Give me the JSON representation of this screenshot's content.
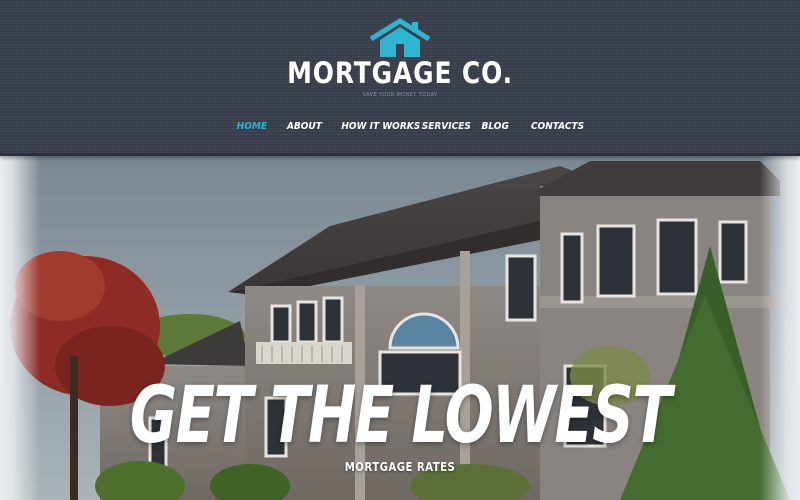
{
  "brand": {
    "title": "MORTGAGE CO.",
    "tagline": "SAVE YOUR MONEY TODAY",
    "logo_icon": "house-icon",
    "accent_color": "#2fb5cf"
  },
  "nav": {
    "items": [
      {
        "label": "HOME",
        "active": true
      },
      {
        "label": "ABOUT",
        "active": false
      },
      {
        "label": "HOW IT WORKS",
        "active": false
      },
      {
        "label": "SERVICES",
        "active": false
      },
      {
        "label": "BLOG",
        "active": false
      },
      {
        "label": "CONTACTS",
        "active": false
      }
    ]
  },
  "hero": {
    "headline": "GET THE LOWEST",
    "subheadline": "MORTGAGE RATES"
  },
  "colors": {
    "header_bg": "#3a3f4d",
    "nav_text": "#ffffff",
    "nav_active": "#2fb5cf"
  }
}
